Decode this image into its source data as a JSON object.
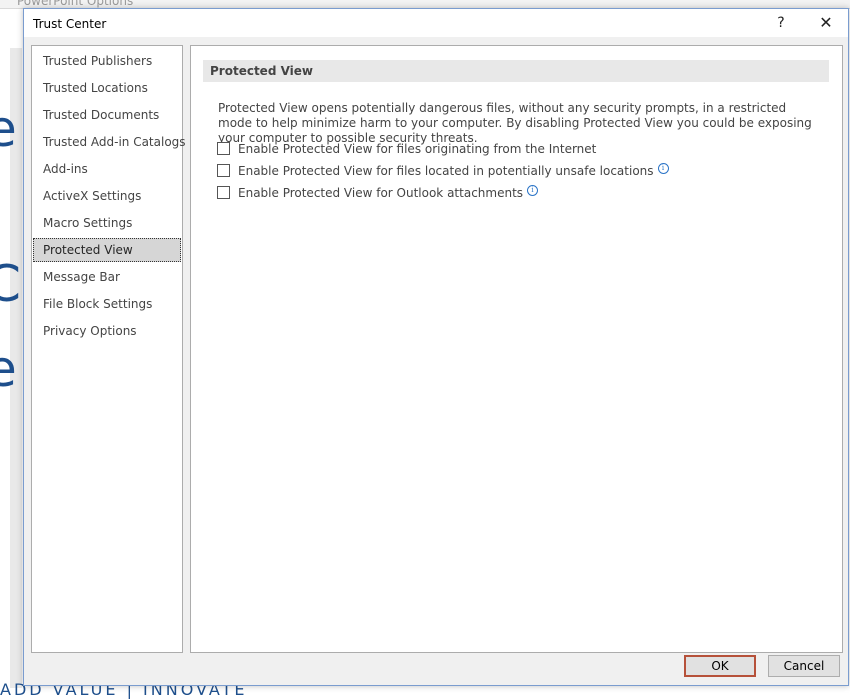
{
  "background": {
    "title": "PowerPoint Options",
    "bottom_text": "ADD VALUE | INNOVATE",
    "letters": [
      "e",
      "C",
      "e"
    ]
  },
  "dialog": {
    "title": "Trust Center",
    "help_label": "?",
    "close_label": "✕"
  },
  "nav": {
    "items": [
      {
        "label": "Trusted Publishers"
      },
      {
        "label": "Trusted Locations"
      },
      {
        "label": "Trusted Documents"
      },
      {
        "label": "Trusted Add-in Catalogs"
      },
      {
        "label": "Add-ins"
      },
      {
        "label": "ActiveX Settings"
      },
      {
        "label": "Macro Settings"
      },
      {
        "label": "Protected View"
      },
      {
        "label": "Message Bar"
      },
      {
        "label": "File Block Settings"
      },
      {
        "label": "Privacy Options"
      }
    ],
    "selected": "Protected View"
  },
  "main": {
    "section_title": "Protected View",
    "description": "Protected View opens potentially dangerous files, without any security prompts, in a restricted mode to help minimize harm to your computer. By disabling Protected View you could be exposing your computer to possible security threats.",
    "options": [
      {
        "label": "Enable Protected View for files originating from the Internet",
        "checked": false,
        "info": false
      },
      {
        "label": "Enable Protected View for files located in potentially unsafe locations",
        "checked": false,
        "info": true
      },
      {
        "label": "Enable Protected View for Outlook attachments",
        "checked": false,
        "info": true
      }
    ],
    "info_glyph": "i"
  },
  "footer": {
    "ok_label": "OK",
    "cancel_label": "Cancel"
  },
  "colors": {
    "accent_border": "#b6513a",
    "info_blue": "#2b74c7",
    "selected_bg": "#d6d6d6"
  }
}
